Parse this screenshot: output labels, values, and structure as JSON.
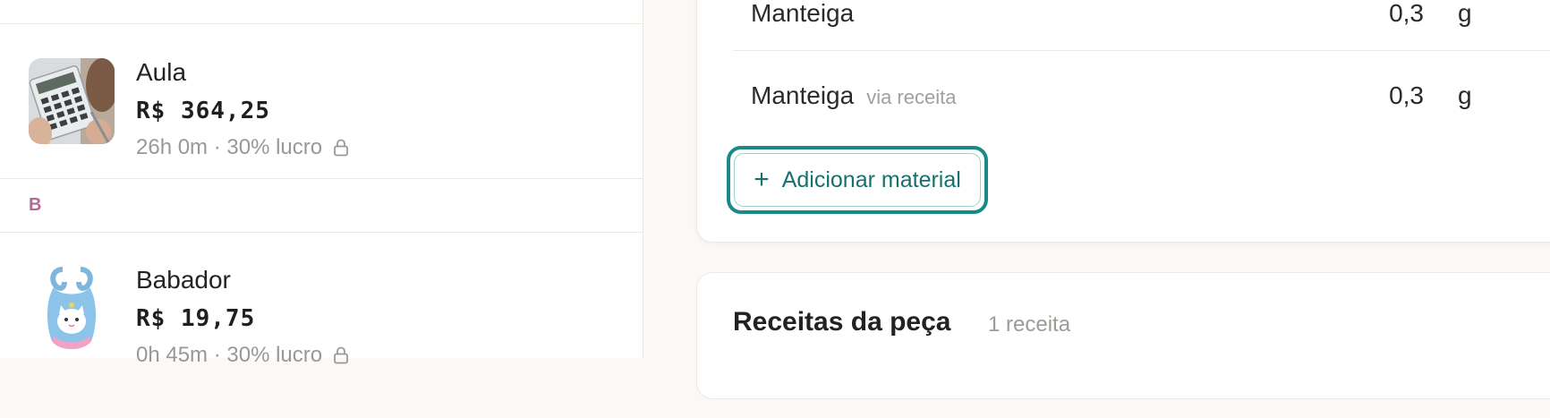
{
  "pieces": [
    {
      "section": "",
      "name": "Aula",
      "price": "R$ 364,25",
      "meta": "26h 0m · 30% lucro",
      "image": "calculator-photo"
    },
    {
      "section": "B",
      "name": "Babador",
      "price": "R$ 19,75",
      "meta": "0h 45m · 30% lucro",
      "image": "bib-photo"
    }
  ],
  "materials": [
    {
      "name": "Manteiga",
      "via": "",
      "qty": "0,3",
      "unit": "g"
    },
    {
      "name": "Manteiga",
      "via": "via receita",
      "qty": "0,3",
      "unit": "g"
    }
  ],
  "add_material_label": "Adicionar material",
  "recipes_section": {
    "title": "Receitas da peça",
    "count": "1 receita"
  },
  "colors": {
    "accent": "#1a8a88",
    "section_letter": "#b06a93"
  },
  "icons": {
    "lock": "lock-icon",
    "plus": "plus-icon"
  }
}
